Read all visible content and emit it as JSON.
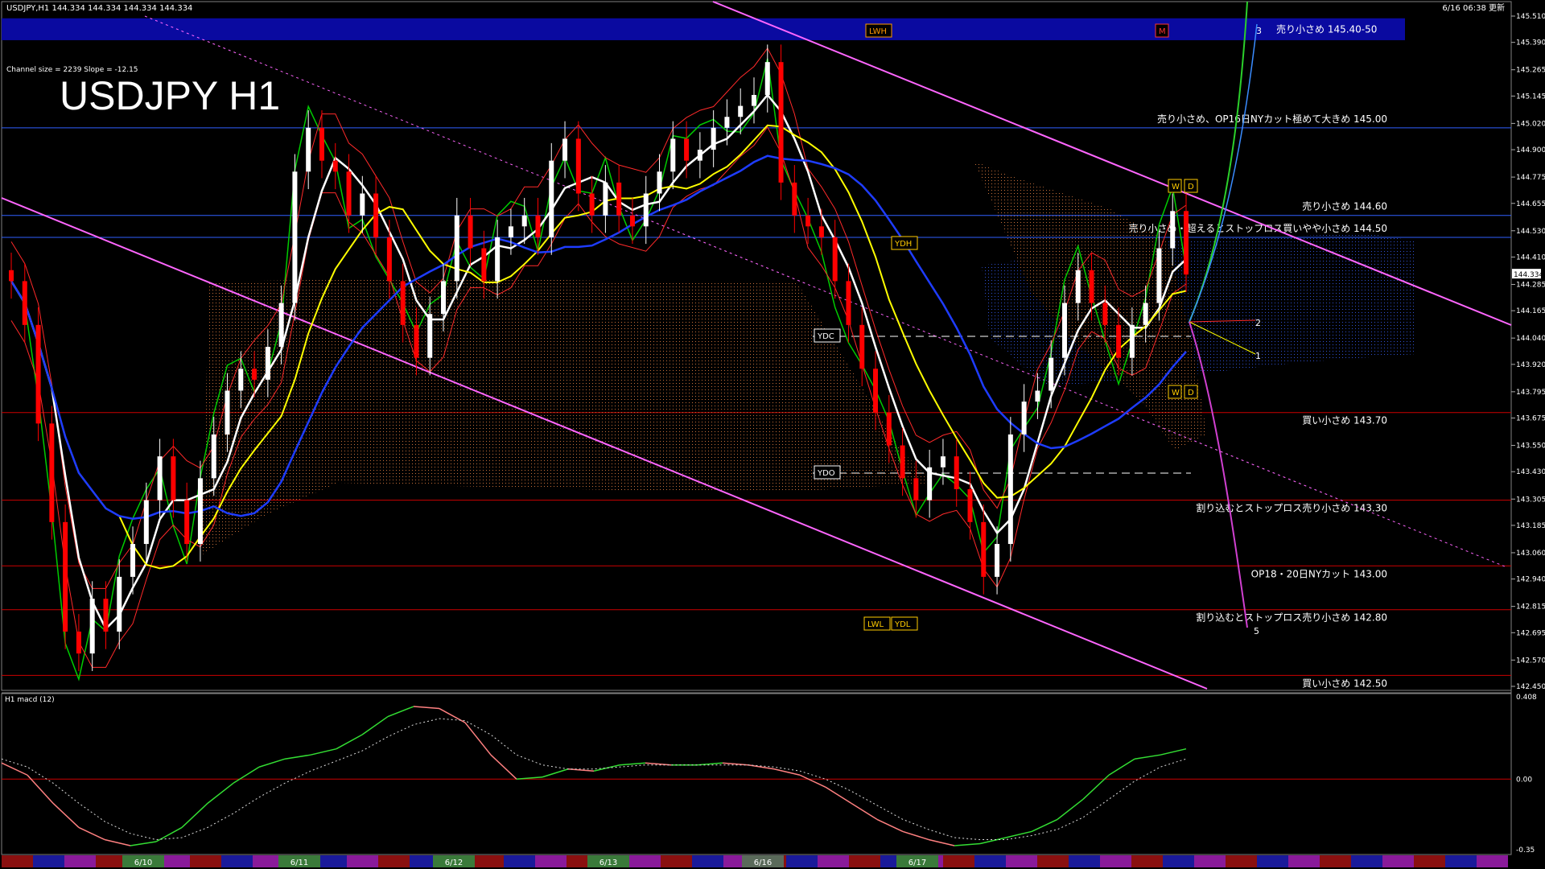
{
  "header": {
    "symbol_line": "USDJPY,H1  144.334 144.334 144.334 144.334",
    "timestamp": "6/16 06:38 更新",
    "channel_info": "Channel size = 2239 Slope = -12.15",
    "big_title": "USDJPY H1"
  },
  "macd_label": "H1  macd (12)",
  "colors": {
    "background": "#000000",
    "bull_candle": "#ffffff",
    "bear_candle": "#ff0000",
    "tenkan": "#00cc00",
    "kijun": "#ff2a2a",
    "ma_fast": "#ffffff",
    "ma_mid": "#ffff00",
    "ma_slow": "#1e3cff",
    "channel": "#ff66ff",
    "level_red": "#cc0000",
    "level_blue": "#3060ff",
    "band_zone": "#0a0aa0"
  },
  "chart_data": [
    {
      "type": "candlestick",
      "title": "USDJPY H1",
      "y_axis_ticks": [
        "145.510",
        "145.390",
        "145.265",
        "145.145",
        "145.020",
        "144.900",
        "144.775",
        "144.655",
        "144.530",
        "144.410",
        "144.285",
        "144.165",
        "144.040",
        "143.920",
        "143.795",
        "143.675",
        "143.550",
        "143.430",
        "143.305",
        "143.185",
        "143.060",
        "142.940",
        "142.815",
        "142.695",
        "142.570",
        "142.450"
      ],
      "ylim": [
        142.45,
        145.51
      ],
      "current_price": "144.334",
      "x_date_labels": [
        "6/10",
        "6/11",
        "6/12",
        "6/13",
        "6/16",
        "6/17"
      ],
      "closes": [
        144.3,
        144.1,
        143.65,
        143.2,
        142.7,
        142.6,
        142.85,
        142.7,
        142.95,
        143.1,
        143.3,
        143.5,
        143.3,
        143.1,
        143.4,
        143.6,
        143.8,
        143.9,
        143.85,
        144.0,
        144.2,
        144.8,
        145.0,
        144.85,
        144.8,
        144.6,
        144.7,
        144.5,
        144.3,
        144.1,
        143.95,
        144.15,
        144.3,
        144.6,
        144.45,
        144.3,
        144.5,
        144.55,
        144.6,
        144.5,
        144.85,
        144.95,
        144.7,
        144.6,
        144.75,
        144.6,
        144.55,
        144.7,
        144.8,
        144.95,
        144.85,
        144.9,
        145.0,
        145.05,
        145.1,
        145.15,
        145.3,
        144.75,
        144.6,
        144.55,
        144.5,
        144.3,
        144.1,
        143.9,
        143.7,
        143.55,
        143.4,
        143.3,
        143.45,
        143.5,
        143.35,
        143.2,
        142.95,
        143.1,
        143.6,
        143.75,
        143.8,
        143.95,
        144.2,
        144.35,
        144.2,
        144.1,
        143.95,
        144.1,
        144.2,
        144.45,
        144.62,
        144.33
      ],
      "price_levels": [
        {
          "label": "売り小さめ 145.40-50",
          "price": 145.45,
          "kind": "band"
        },
        {
          "label": "売り小さめ、OP16日NYカット極めて大きめ 145.00",
          "price": 145.0,
          "kind": "blue"
        },
        {
          "label": "売り小さめ 144.60",
          "price": 144.6,
          "kind": "blue"
        },
        {
          "label": "売り小さめ・超えるとストップロス買いやや小さめ 144.50",
          "price": 144.5,
          "kind": "blue"
        },
        {
          "label": "買い小さめ 143.70",
          "price": 143.7,
          "kind": "red"
        },
        {
          "label": "割り込むとストップロス売り小さめ 143.30",
          "price": 143.3,
          "kind": "red"
        },
        {
          "label": "OP18・20日NYカット 143.00",
          "price": 143.0,
          "kind": "red"
        },
        {
          "label": "割り込むとストップロス売り小さめ 142.80",
          "price": 142.8,
          "kind": "red"
        },
        {
          "label": "買い小さめ 142.50",
          "price": 142.5,
          "kind": "red"
        }
      ],
      "marker_labels": [
        "LWH",
        "M",
        "YDH",
        "YDC",
        "YDO",
        "LWL",
        "YDL",
        "W",
        "D",
        "W",
        "D"
      ],
      "projection_labels": [
        "3",
        "2",
        "1",
        "5"
      ]
    },
    {
      "type": "line",
      "title": "H1 macd (12)",
      "y_axis_ticks": [
        "0.408",
        "0.00",
        "-0.35"
      ],
      "ylim": [
        -0.35,
        0.408
      ],
      "series": [
        {
          "name": "macd",
          "values": [
            0.08,
            0.02,
            -0.12,
            -0.24,
            -0.3,
            -0.33,
            -0.31,
            -0.24,
            -0.12,
            -0.02,
            0.06,
            0.1,
            0.12,
            0.15,
            0.22,
            0.31,
            0.36,
            0.35,
            0.28,
            0.12,
            0.0,
            0.01,
            0.05,
            0.04,
            0.07,
            0.08,
            0.07,
            0.07,
            0.08,
            0.07,
            0.05,
            0.02,
            -0.04,
            -0.12,
            -0.2,
            -0.26,
            -0.3,
            -0.33,
            -0.32,
            -0.29,
            -0.26,
            -0.2,
            -0.1,
            0.02,
            0.1,
            0.12,
            0.15
          ]
        },
        {
          "name": "signal",
          "values": [
            0.1,
            0.06,
            -0.02,
            -0.12,
            -0.21,
            -0.27,
            -0.3,
            -0.29,
            -0.24,
            -0.17,
            -0.09,
            -0.02,
            0.04,
            0.09,
            0.14,
            0.21,
            0.27,
            0.3,
            0.29,
            0.22,
            0.12,
            0.07,
            0.05,
            0.05,
            0.06,
            0.07,
            0.07,
            0.07,
            0.07,
            0.07,
            0.06,
            0.04,
            0.0,
            -0.06,
            -0.13,
            -0.2,
            -0.25,
            -0.29,
            -0.3,
            -0.3,
            -0.28,
            -0.25,
            -0.19,
            -0.1,
            -0.01,
            0.06,
            0.1
          ]
        }
      ]
    }
  ]
}
